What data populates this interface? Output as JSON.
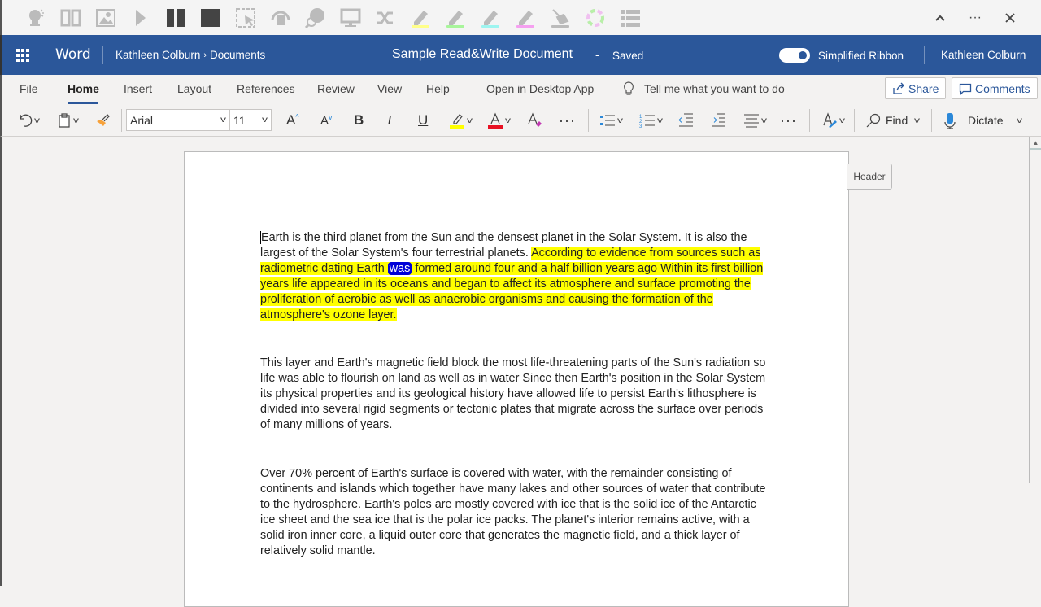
{
  "rw_toolbar": {
    "icons": [
      "predict-icon",
      "dictionary-icon",
      "picture-dictionary-icon",
      "play-icon",
      "pause-icon",
      "stop-icon",
      "screenshot-reader-icon",
      "audio-maker-icon",
      "translator-icon",
      "screen-mask-icon",
      "check-it-icon",
      "highlight-yellow-icon",
      "highlight-green-icon",
      "highlight-cyan-icon",
      "highlight-pink-icon",
      "clear-highlights-icon",
      "collect-highlights-icon",
      "vocabulary-list-icon"
    ],
    "highlight_colors": {
      "yellow": "#ffff8a",
      "green": "#a8f59b",
      "cyan": "#9ef5f0",
      "pink": "#f5a0f0"
    }
  },
  "window_controls": {
    "collapse": "⌃",
    "more": "···",
    "close": "✕"
  },
  "header": {
    "app_name": "Word",
    "breadcrumb": [
      "Kathleen Colburn",
      "Documents"
    ],
    "doc_title": "Sample Read&Write Document",
    "separator": "-",
    "status": "Saved",
    "toggle_label": "Simplified Ribbon",
    "toggle_on": true,
    "user": "Kathleen Colburn",
    "brand_color": "#2b579a"
  },
  "tabs": {
    "items": [
      "File",
      "Home",
      "Insert",
      "Layout",
      "References",
      "Review",
      "View",
      "Help",
      "Open in Desktop App"
    ],
    "active": "Home",
    "tell_me": "Tell me what you want to do",
    "share": "Share",
    "comments": "Comments"
  },
  "ribbon": {
    "font_name": "Arial",
    "font_size": "11",
    "find": "Find",
    "dictate": "Dictate",
    "highlight_color": "#ffff00",
    "font_color": "#e81123"
  },
  "document": {
    "header_tag": "Header",
    "p1_plain": "Earth is the third planet from the Sun and the densest planet in the Solar System. It is also the largest of the Solar System's four terrestrial planets. ",
    "p1_hl_before": "According to evidence from sources such as radiometric dating Earth ",
    "p1_current_word": "was",
    "p1_hl_after": " formed around four and a half billion years ago Within its first billion years life appeared in its oceans and began to affect its atmosphere and surface promoting the proliferation of aerobic as well as anaerobic organisms and causing the formation of the atmosphere's ozone layer. ",
    "p2": "This layer and Earth's magnetic field block the most life-threatening parts of the Sun's radiation so life was able to flourish on land as well as in water Since then Earth's position in the Solar System its physical properties and its geological history have allowed life to persist Earth's lithosphere is divided into several rigid segments or tectonic plates that migrate across the surface over periods of many millions of years.",
    "p3": "Over 70% percent of Earth's surface is covered with water, with the remainder consisting of continents and islands which together have many lakes and other sources of water that contribute to the hydrosphere. Earth's poles are mostly covered with ice that is the solid ice of the Antarctic ice sheet and the sea ice that is the polar ice packs. The planet's interior remains active, with a solid iron inner core, a liquid outer core that generates the magnetic field, and a thick layer of relatively solid mantle."
  }
}
